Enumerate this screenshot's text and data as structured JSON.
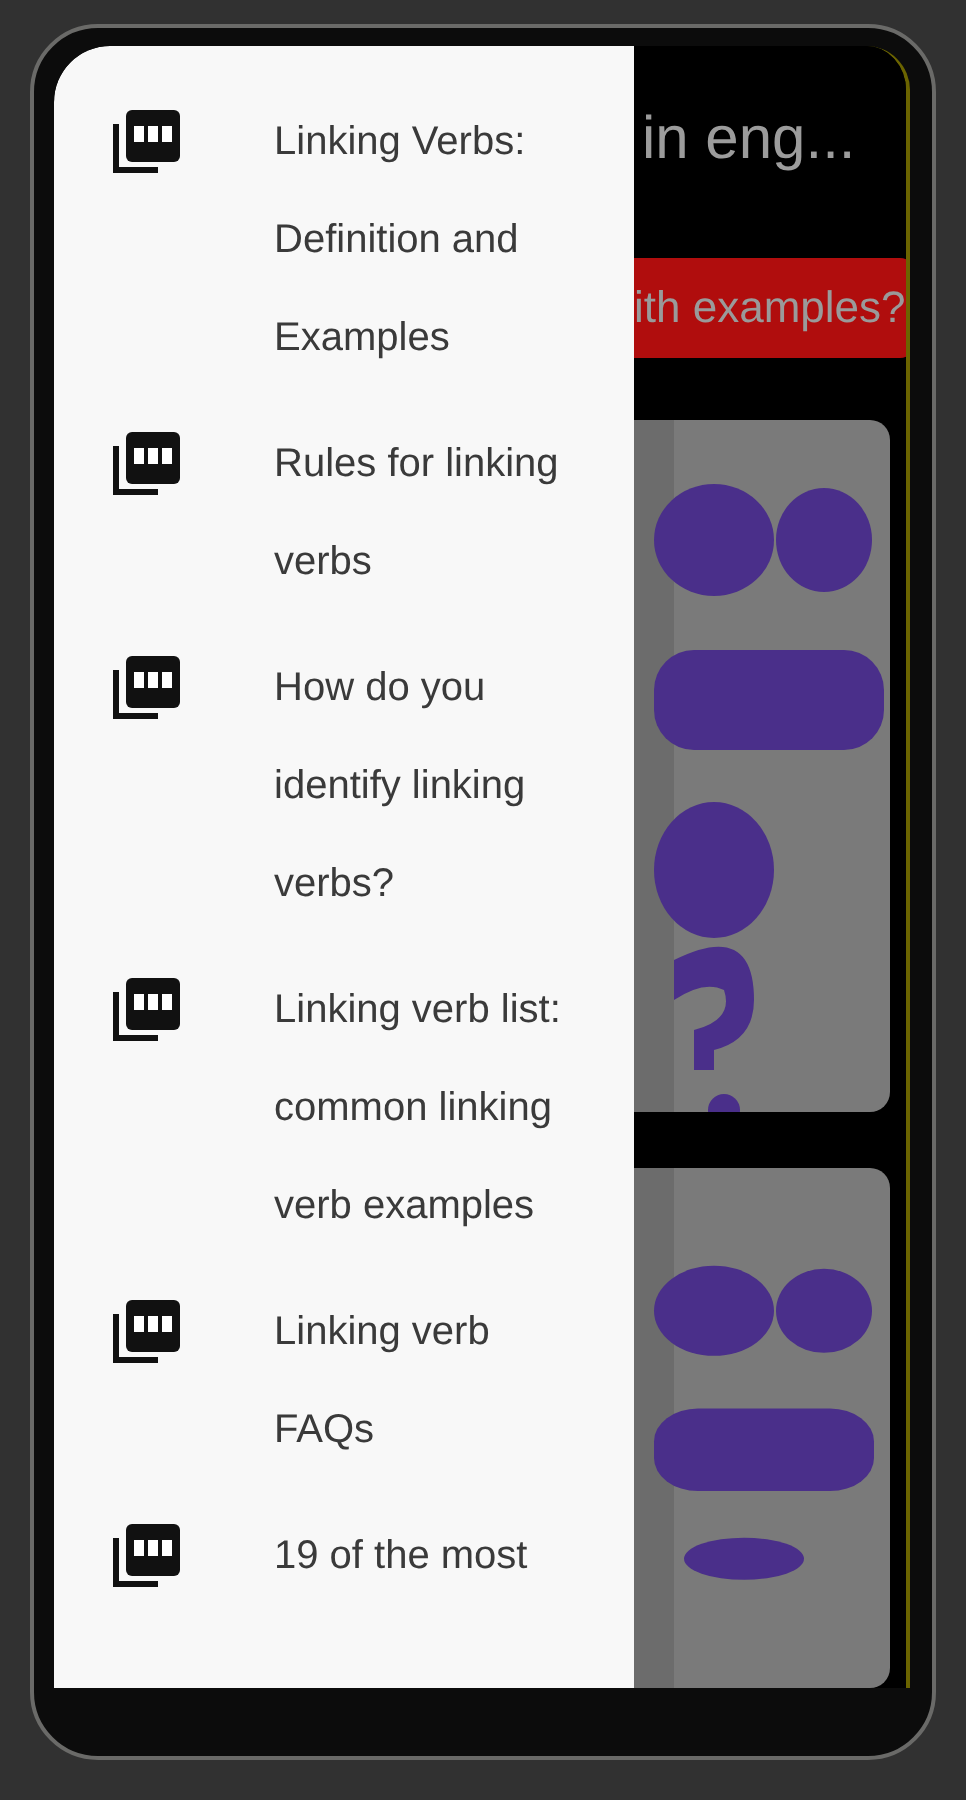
{
  "app_bar": {
    "title": "in eng..."
  },
  "button": {
    "label": "ith examples?"
  },
  "drawer": {
    "items": [
      {
        "label": "Linking Verbs: Definition and Examples"
      },
      {
        "label": "Rules for linking verbs"
      },
      {
        "label": "How do you identify linking verbs?"
      },
      {
        "label": "Linking verb list: common linking verb examples"
      },
      {
        "label": "Linking verb FAQs"
      },
      {
        "label": "19 of the most"
      }
    ]
  }
}
